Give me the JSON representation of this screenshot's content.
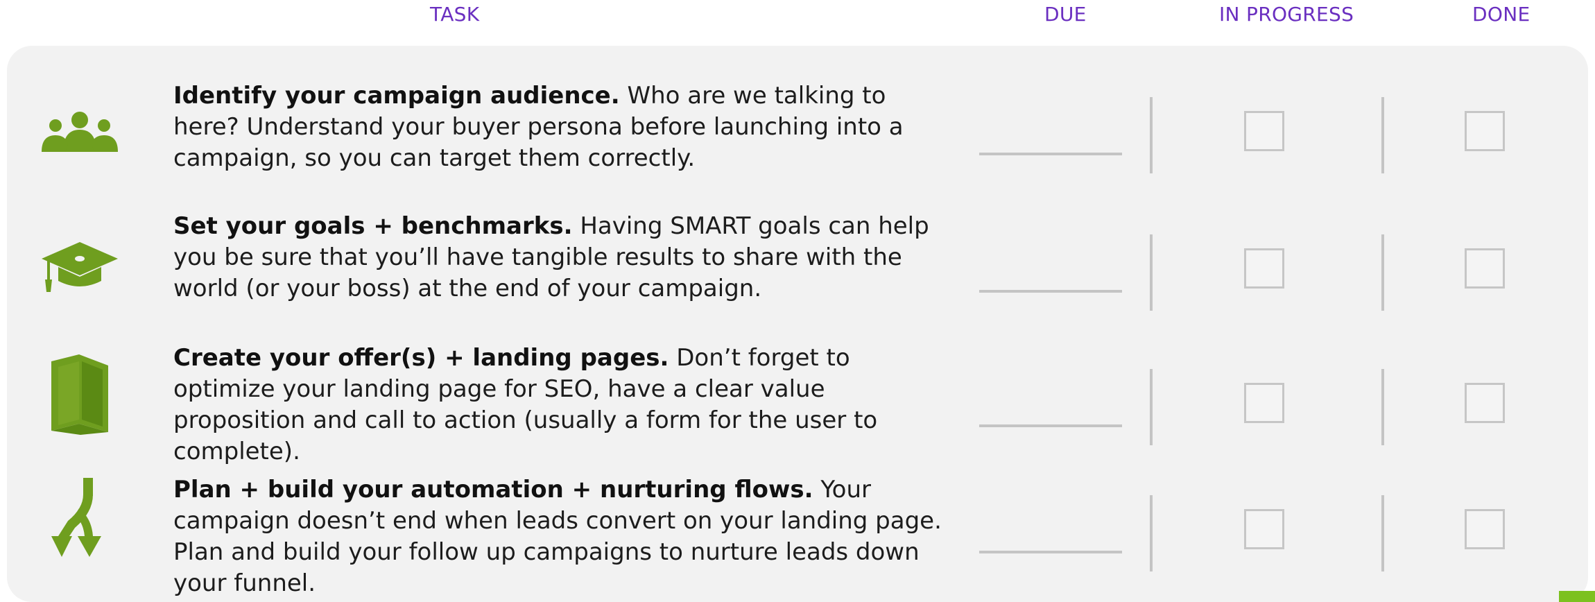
{
  "columns": {
    "task": "TASK",
    "due": "DUE",
    "in_progress": "IN PROGRESS",
    "done": "DONE"
  },
  "colors": {
    "header": "#6a2fc0",
    "icon_green": "#6f9e1f",
    "panel_bg": "#f2f2f2",
    "accent_green": "#7cc11f"
  },
  "tasks": [
    {
      "icon": "people-group-icon",
      "title": "Identify your campaign audience.",
      "body": " Who are we talking to here? Understand your buyer persona before launching into a campaign, so you can target them correctly."
    },
    {
      "icon": "graduation-cap-icon",
      "title": "Set your goals + benchmarks.",
      "body": " Having SMART goals can help you be sure that you’ll have tangible results to share with the world (or your boss) at the end of your campaign."
    },
    {
      "icon": "book-icon",
      "title": "Create your offer(s) + landing pages.",
      "body": " Don’t forget to optimize your landing page for SEO, have a clear value proposition and call to action (usually a form for the user to complete)."
    },
    {
      "icon": "split-arrows-icon",
      "title": "Plan + build your automation + nurturing flows.",
      "body": " Your campaign doesn’t end when leads convert on your landing page. Plan and build your follow up campaigns to nurture leads down your funnel."
    }
  ]
}
